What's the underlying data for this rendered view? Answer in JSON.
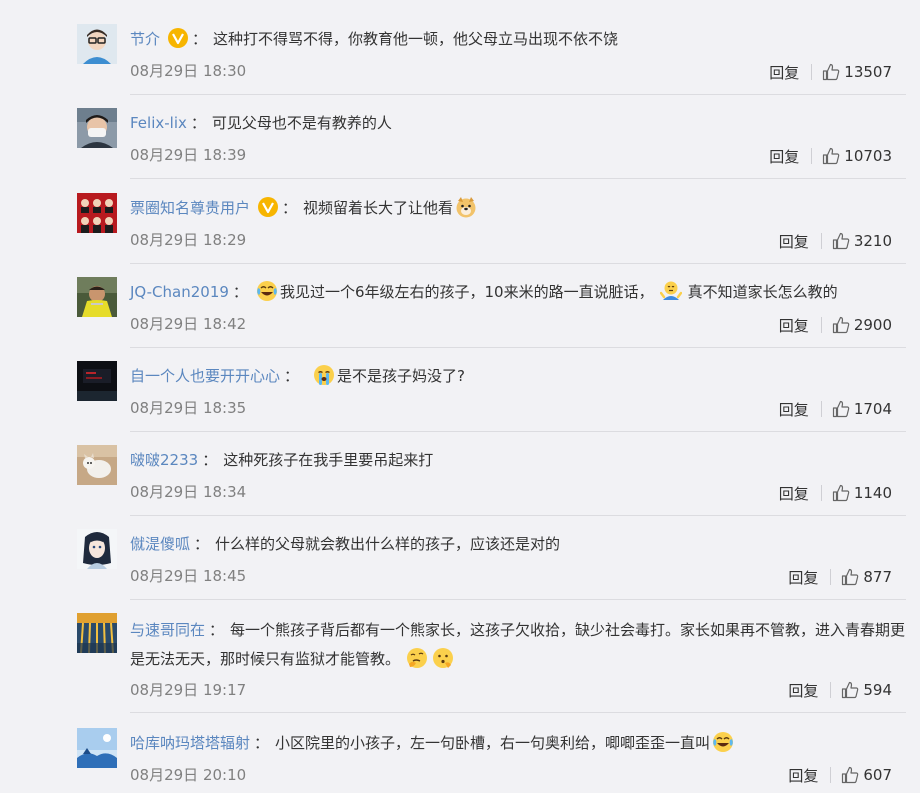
{
  "comments": [
    {
      "user": "节介",
      "verified": true,
      "text": "这种打不得骂不得，你教育他一顿，他父母立马出现不依不饶",
      "time": "08月29日 18:30",
      "reply": "回复",
      "likes": "13507"
    },
    {
      "user": "Felix-lix",
      "verified": false,
      "text": "可见父母也不是有教养的人",
      "time": "08月29日 18:39",
      "reply": "回复",
      "likes": "10703"
    },
    {
      "user": "票圈知名尊贵用户",
      "verified": true,
      "text": "视频留着长大了让他看",
      "time": "08月29日 18:29",
      "reply": "回复",
      "likes": "3210"
    },
    {
      "user": "JQ-Chan2019",
      "verified": false,
      "text_a": "我见过一个6年级左右的孩子，10来米的路一直说脏话，",
      "text_b": "真不知道家长怎么教的",
      "time": "08月29日 18:42",
      "reply": "回复",
      "likes": "2900"
    },
    {
      "user": "自一个人也要开开心心",
      "verified": false,
      "text": "是不是孩子妈没了?",
      "time": "08月29日 18:35",
      "reply": "回复",
      "likes": "1704"
    },
    {
      "user": "啵啵2233",
      "verified": false,
      "text": "这种死孩子在我手里要吊起来打",
      "time": "08月29日 18:34",
      "reply": "回复",
      "likes": "1140"
    },
    {
      "user": "僦湜傻呱",
      "verified": false,
      "text": "什么样的父母就会教出什么样的孩子，应该还是对的",
      "time": "08月29日 18:45",
      "reply": "回复",
      "likes": "877"
    },
    {
      "user": "与速哥同在",
      "verified": false,
      "text": "每一个熊孩子背后都有一个熊家长，这孩子欠收拾，缺少社会毒打。家长如果再不管教，进入青春期更是无法无天，那时候只有监狱才能管教。",
      "time": "08月29日 19:17",
      "reply": "回复",
      "likes": "594"
    },
    {
      "user": "哈库呐玛塔塔辐射",
      "verified": false,
      "text": "小区院里的小孩子，左一句卧槽，右一句奥利给，唧唧歪歪一直叫",
      "time": "08月29日 20:10",
      "reply": "回复",
      "likes": "607"
    }
  ],
  "colon": "：",
  "colors": {
    "username": "#5b87bf",
    "time": "#808080",
    "background": "#f2f2f5",
    "badge": "#f7b500"
  },
  "icons": {
    "like": "thumbs-up-icon",
    "verified": "verified-badge-icon"
  }
}
